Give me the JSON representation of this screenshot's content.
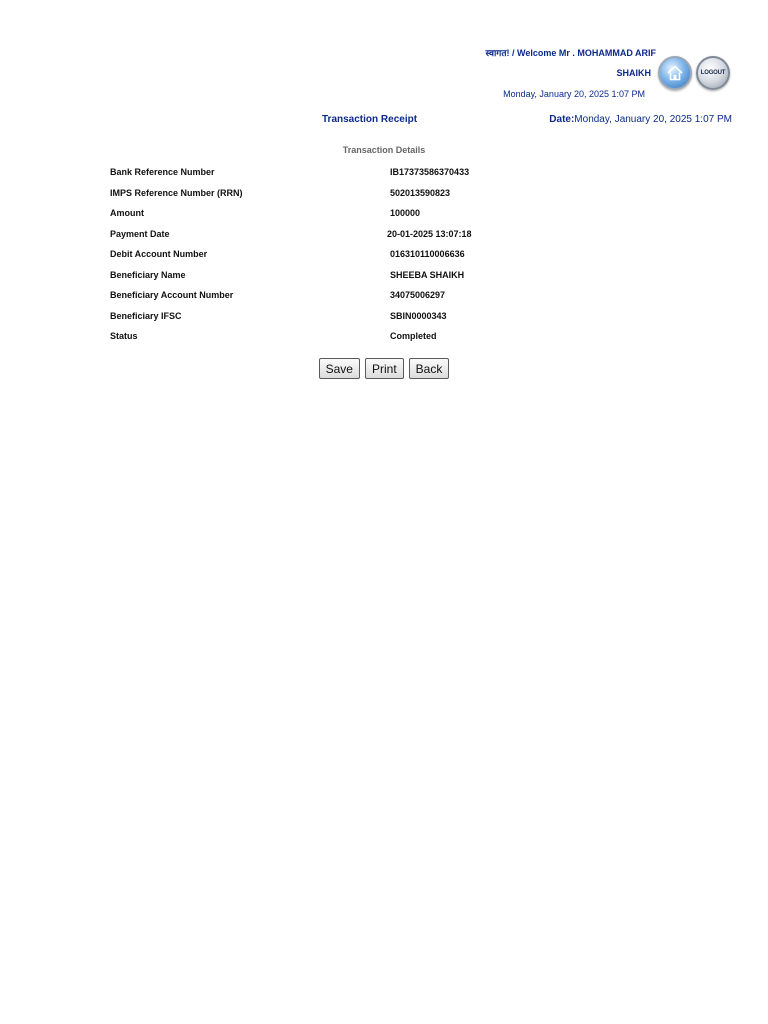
{
  "header": {
    "welcome_line": "स्वागत! / Welcome Mr . MOHAMMAD ARIF",
    "welcome_line2": "SHAIKH",
    "date": "Monday, January 20, 2025 1:07 PM",
    "logout_label": "LOGOUT"
  },
  "receipt": {
    "title": "Transaction Receipt",
    "date_label": "Date:",
    "date_value": "Monday, January 20, 2025 1:07 PM",
    "section_title": "Transaction Details"
  },
  "details": [
    {
      "label": "Bank Reference Number",
      "value": "IB17373586370433"
    },
    {
      "label": "IMPS Reference Number (RRN)",
      "value": "502013590823"
    },
    {
      "label": "Amount",
      "value": "100000"
    },
    {
      "label": "Payment Date",
      "value": "20-01-2025 13:07:18"
    },
    {
      "label": "Debit Account Number",
      "value": "016310110006636"
    },
    {
      "label": "Beneficiary Name",
      "value": "SHEEBA SHAIKH"
    },
    {
      "label": "Beneficiary Account Number",
      "value": "34075006297"
    },
    {
      "label": "Beneficiary IFSC",
      "value": "SBIN0000343"
    },
    {
      "label": "Status",
      "value": "Completed"
    }
  ],
  "buttons": {
    "save": "Save",
    "print": "Print",
    "back": "Back"
  },
  "icons": {
    "home": "home-icon",
    "logout": "logout-icon"
  }
}
